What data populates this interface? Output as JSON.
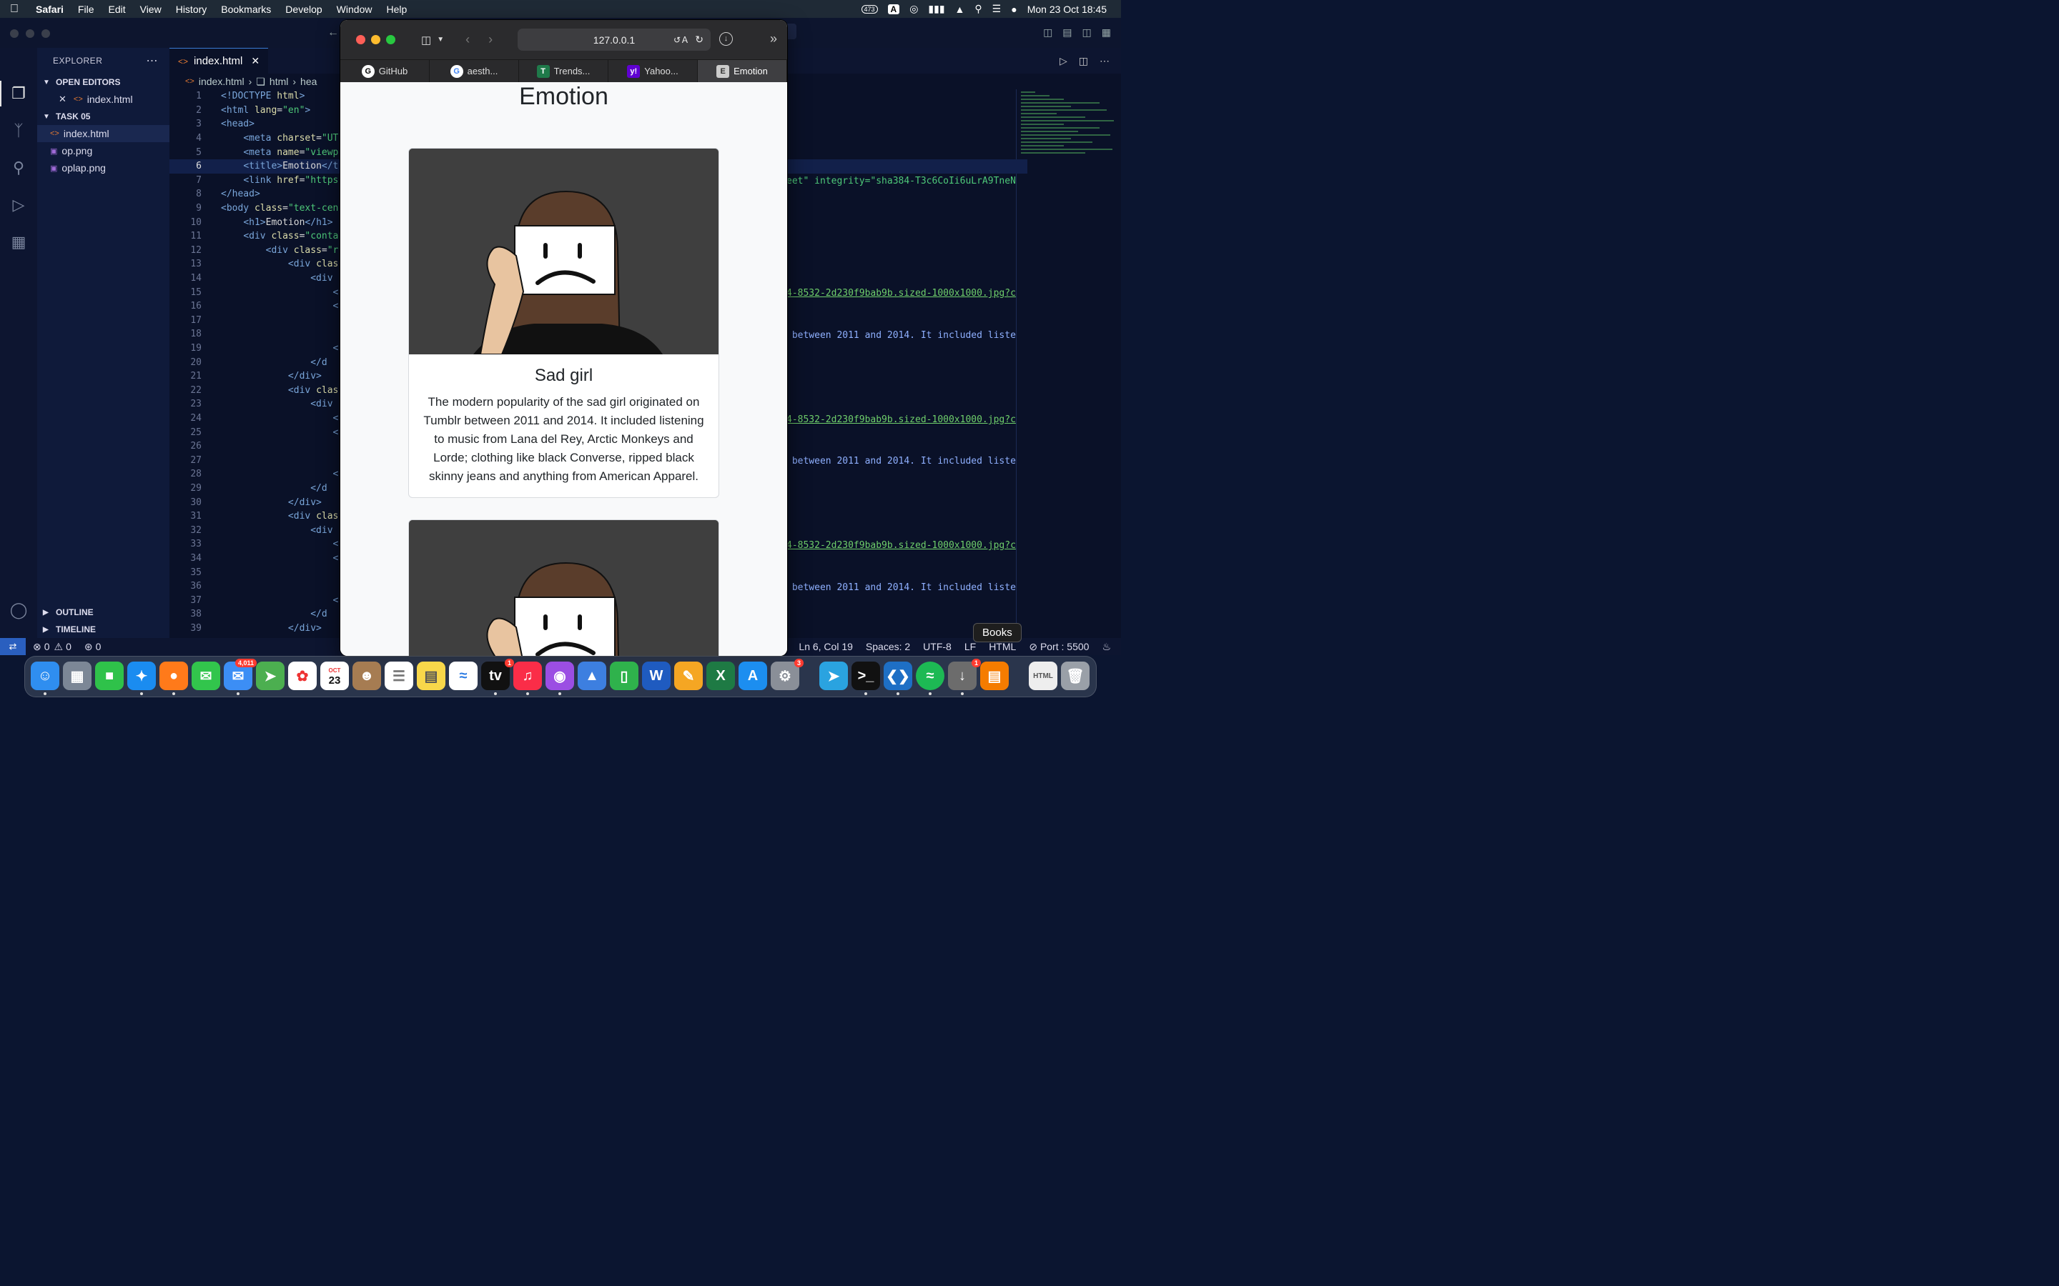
{
  "menubar": {
    "app": "Safari",
    "items": [
      "File",
      "Edit",
      "View",
      "History",
      "Bookmarks",
      "Develop",
      "Window",
      "Help"
    ],
    "notif_count": "473",
    "input_source": "A",
    "datetime": "Mon 23 Oct  18:45"
  },
  "vscode": {
    "explorer_title": "EXPLORER",
    "open_editors": "OPEN EDITORS",
    "open_file": "index.html",
    "folder": "TASK 05",
    "files": [
      "index.html",
      "op.png",
      "oplap.png"
    ],
    "outline": "OUTLINE",
    "timeline": "TIMELINE",
    "tab": "index.html",
    "breadcrumb": [
      "index.html",
      "html",
      "hea"
    ],
    "line_numbers": [
      "1",
      "2",
      "3",
      "4",
      "5",
      "6",
      "7",
      "8",
      "9",
      "10",
      "11",
      "12",
      "13",
      "14",
      "15",
      "16",
      "17",
      "18",
      "19",
      "20",
      "21",
      "22",
      "23",
      "24",
      "25",
      "26",
      "27",
      "28",
      "29",
      "30",
      "31",
      "32",
      "33",
      "34",
      "35",
      "36",
      "37",
      "38",
      "39"
    ],
    "right_snippets": {
      "integrity": "eet\" integrity=\"sha384-T3c6CoIi6uLrA9TneN",
      "url": "4-8532-2d230f9bab9b.sized-1000x1000.jpg?c",
      "text": " between 2011 and 2014. It included liste"
    },
    "status": {
      "errors": "0",
      "warnings": "0",
      "ports": "0",
      "position": "Ln 6, Col 19",
      "spaces": "Spaces: 2",
      "encoding": "UTF-8",
      "eol": "LF",
      "language": "HTML",
      "port": "Port : 5500"
    }
  },
  "safari": {
    "url": "127.0.0.1",
    "tabs": [
      {
        "label": "GitHub",
        "fav": "G"
      },
      {
        "label": "aesth...",
        "fav": "G"
      },
      {
        "label": "Trends...",
        "fav": "T"
      },
      {
        "label": "Yahoo...",
        "fav": "y!"
      },
      {
        "label": "Emotion",
        "fav": "E"
      }
    ],
    "page": {
      "heading": "Emotion",
      "card_title": "Sad girl",
      "card_text": "The modern popularity of the sad girl originated on Tumblr between 2011 and 2014. It included listening to music from Lana del Rey, Arctic Monkeys and Lorde; clothing like black Converse, ripped black skinny jeans and anything from American Apparel."
    }
  },
  "dock": {
    "tooltip": "Books",
    "badges": {
      "mail": "4,011",
      "tv": "1",
      "settings": "3",
      "installer": "1"
    },
    "calendar_month": "OCT",
    "calendar_day": "23"
  },
  "colors": {
    "vscode_bg": "#0a1128",
    "safari_toolbar": "#2b2b2d",
    "accent": "#2a5fbf"
  }
}
